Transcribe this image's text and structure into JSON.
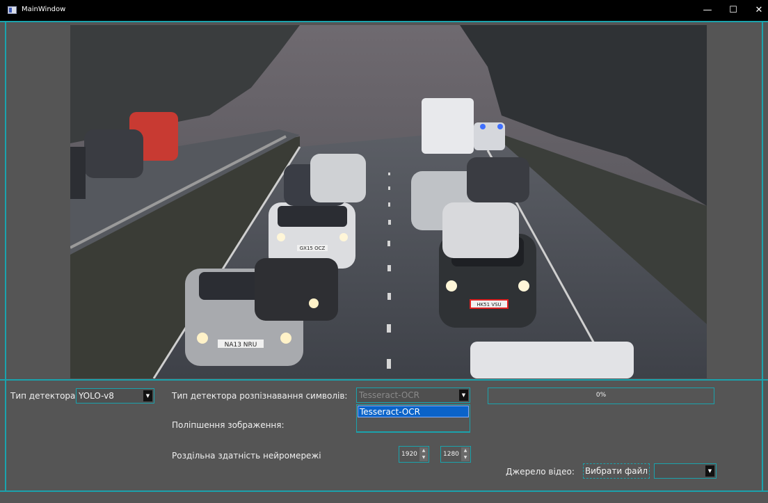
{
  "window": {
    "title": "MainWindow",
    "minimize_glyph": "—",
    "maximize_glyph": "☐",
    "close_glyph": "✕"
  },
  "video": {
    "plates": [
      "NA13 NRU",
      "GX15 OCZ",
      "HK51 VSU"
    ]
  },
  "controls": {
    "detector_label": "Тип детектора:",
    "detector_value": "YOLO-v8",
    "ocr_label": "Тип детектора розпізнавання символів:",
    "ocr_value": "Tesseract-OCR",
    "ocr_dropdown_options": [
      "Tesseract-OCR"
    ],
    "enhance_label": "Поліпшення зображення:",
    "resolution_label": "Роздільна здатність нейромережі",
    "resolution_width": "1920",
    "resolution_height": "1280",
    "progress_text": "0%",
    "progress_value": 0,
    "source_label": "Джерело відео:",
    "choose_file_label": "Вибрати файл",
    "source_select_value": ""
  },
  "colors": {
    "accent": "#1aa3ad",
    "background": "#555555",
    "titlebar": "#000000",
    "selection": "#0a63c9"
  }
}
